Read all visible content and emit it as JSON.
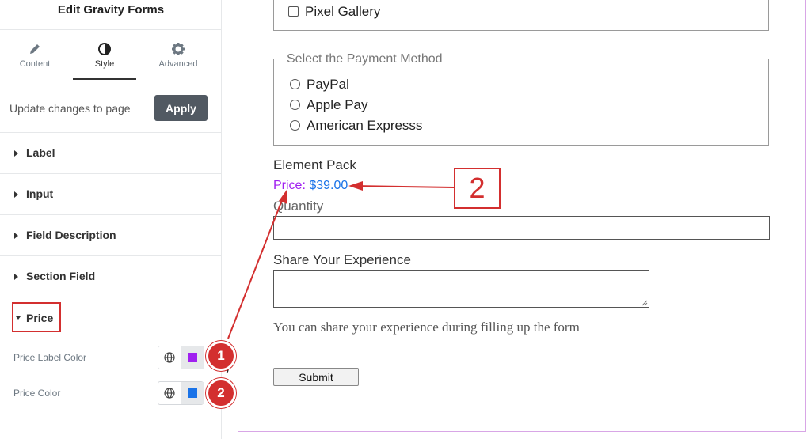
{
  "panel": {
    "title": "Edit Gravity Forms",
    "tabs": [
      {
        "label": "Content",
        "icon": "pencil-icon"
      },
      {
        "label": "Style",
        "icon": "contrast-icon"
      },
      {
        "label": "Advanced",
        "icon": "gear-icon"
      }
    ],
    "active_tab": "Style",
    "update_text": "Update changes to page",
    "apply_label": "Apply",
    "sections": [
      "Label",
      "Input",
      "Field Description",
      "Section Field"
    ],
    "price_section": "Price",
    "controls": [
      {
        "label": "Price Label Color",
        "color": "#a020f0",
        "badge": "1"
      },
      {
        "label": "Price Color",
        "color": "#1a73e8",
        "badge": "2"
      }
    ]
  },
  "form": {
    "checkbox_option": "Pixel Gallery",
    "payment_legend": "Select the Payment Method",
    "payment_options": [
      "PayPal",
      "Apple Pay",
      "American Expresss"
    ],
    "product_name": "Element Pack",
    "price_label": "Price:",
    "price_value": "$39.00",
    "quantity_label": "Quantity",
    "experience_label": "Share Your Experience",
    "experience_help": "You can share your experience during filling up the form",
    "submit_label": "Submit"
  },
  "annotation": {
    "callout_number": "2",
    "accent": "#d32f2f"
  }
}
